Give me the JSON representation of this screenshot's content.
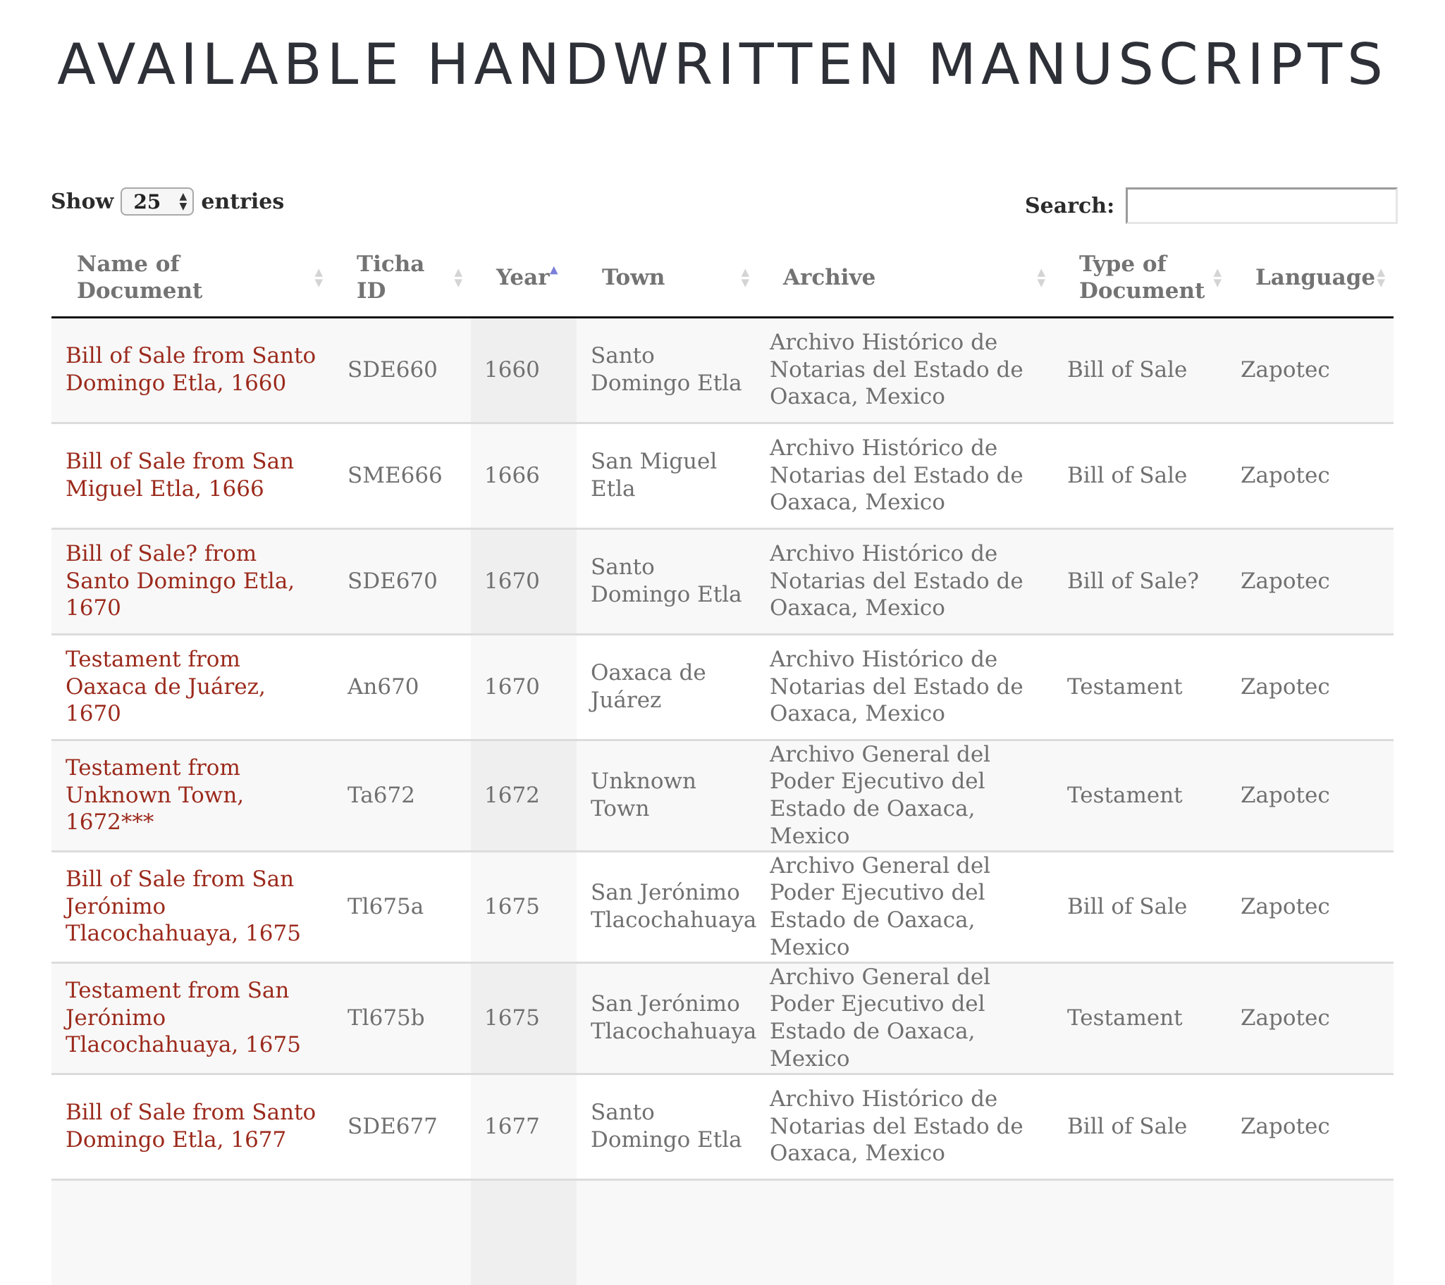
{
  "page": {
    "title": "AVAILABLE HANDWRITTEN MANUSCRIPTS"
  },
  "controls": {
    "show_label": "Show",
    "entries_label": "entries",
    "page_length": "25",
    "search_label": "Search:",
    "search_value": ""
  },
  "colors": {
    "link": "#9b2a1c",
    "sort_active": "#7b7fd9"
  },
  "table": {
    "columns": [
      {
        "label": "Name of Document",
        "sort": "none"
      },
      {
        "label": "Ticha ID",
        "sort": "none"
      },
      {
        "label": "Year",
        "sort": "ascending"
      },
      {
        "label": "Town",
        "sort": "none"
      },
      {
        "label": "Archive",
        "sort": "none"
      },
      {
        "label": "Type of Document",
        "sort": "none"
      },
      {
        "label": "Language",
        "sort": "none"
      }
    ],
    "rows": [
      {
        "name": "Bill of Sale from Santo Domingo Etla, 1660",
        "id": "SDE660",
        "year": "1660",
        "town": "Santo Domingo Etla",
        "archive": "Archivo Histórico de Notarias del Estado de Oaxaca, Mexico",
        "type": "Bill of Sale",
        "language": "Zapotec"
      },
      {
        "name": "Bill of Sale from San Miguel Etla, 1666",
        "id": "SME666",
        "year": "1666",
        "town": "San Miguel Etla",
        "archive": "Archivo Histórico de Notarias del Estado de Oaxaca, Mexico",
        "type": "Bill of Sale",
        "language": "Zapotec"
      },
      {
        "name": "Bill of Sale? from Santo Domingo Etla, 1670",
        "id": "SDE670",
        "year": "1670",
        "town": "Santo Domingo Etla",
        "archive": "Archivo Histórico de Notarias del Estado de Oaxaca, Mexico",
        "type": "Bill of Sale?",
        "language": "Zapotec"
      },
      {
        "name": "Testament from Oaxaca de Juárez, 1670",
        "id": "An670",
        "year": "1670",
        "town": "Oaxaca de Juárez",
        "archive": "Archivo Histórico de Notarias del Estado de Oaxaca, Mexico",
        "type": "Testament",
        "language": "Zapotec"
      },
      {
        "name": "Testament from Unknown Town, 1672***",
        "id": "Ta672",
        "year": "1672",
        "town": "Unknown Town",
        "archive": "Archivo General del Poder Ejecutivo del Estado de Oaxaca, Mexico",
        "type": "Testament",
        "language": "Zapotec"
      },
      {
        "name": "Bill of Sale from San Jerónimo Tlacochahuaya, 1675",
        "id": "Tl675a",
        "year": "1675",
        "town": "San Jerónimo Tlacochahuaya",
        "archive": "Archivo General del Poder Ejecutivo del Estado de Oaxaca, Mexico",
        "type": "Bill of Sale",
        "language": "Zapotec"
      },
      {
        "name": "Testament from San Jerónimo Tlacochahuaya, 1675",
        "id": "Tl675b",
        "year": "1675",
        "town": "San Jerónimo Tlacochahuaya",
        "archive": "Archivo General del Poder Ejecutivo del Estado de Oaxaca, Mexico",
        "type": "Testament",
        "language": "Zapotec"
      },
      {
        "name": "Bill of Sale from Santo Domingo Etla, 1677",
        "id": "SDE677",
        "year": "1677",
        "town": "Santo Domingo Etla",
        "archive": "Archivo Histórico de Notarias del Estado de Oaxaca, Mexico",
        "type": "Bill of Sale",
        "language": "Zapotec"
      },
      {
        "name": "",
        "id": "",
        "year": "",
        "town": "",
        "archive": "",
        "type": "",
        "language": ""
      }
    ]
  }
}
